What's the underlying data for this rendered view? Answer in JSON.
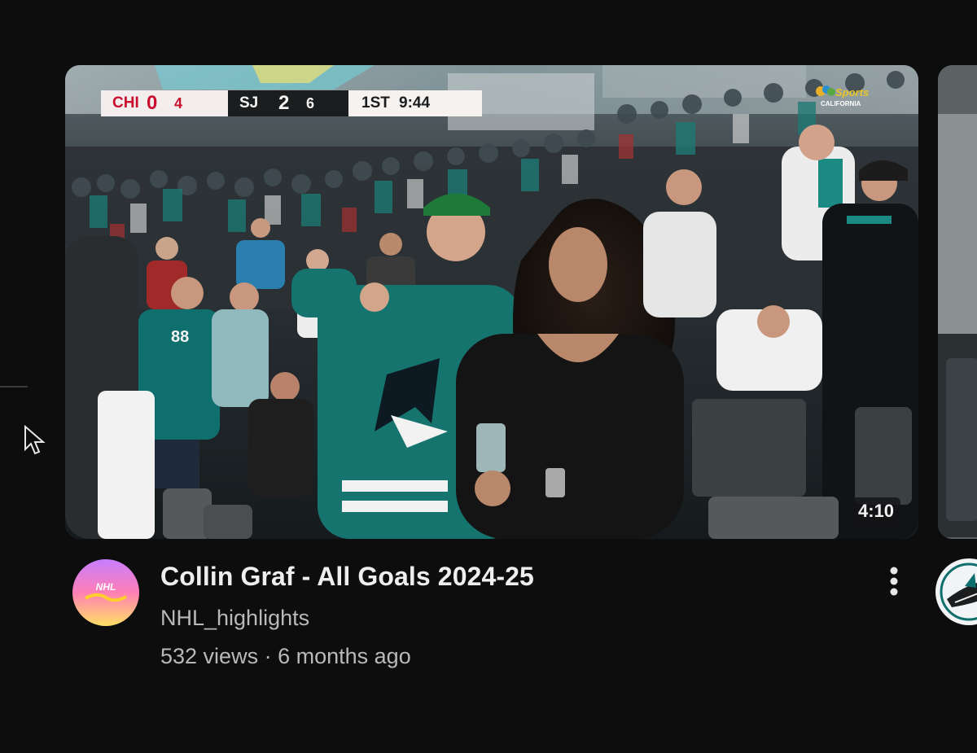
{
  "video": {
    "title": "Collin Graf - All Goals 2024-25",
    "channel": "NHL_highlights",
    "views": "532 views",
    "separator": "·",
    "age": "6 months ago",
    "duration": "4:10",
    "avatar_text": "NHL"
  },
  "scorebug": {
    "away_team": "CHI",
    "away_score": "0",
    "away_shots": "4",
    "home_team": "SJ",
    "home_score": "2",
    "home_shots": "6",
    "period": "1ST",
    "clock": "9:44"
  },
  "network_logo": {
    "line1": "Sports",
    "line2": "CALIFORNIA"
  },
  "colors": {
    "background": "#0d0d0e",
    "title": "#eeeeee",
    "secondary_text": "#b9b9b9",
    "sharks_teal": "#0f6f6c",
    "chi_red": "#c8102e"
  },
  "icons": {
    "menu": "more-vert-icon",
    "pointer": "cursor-arrow-icon"
  }
}
